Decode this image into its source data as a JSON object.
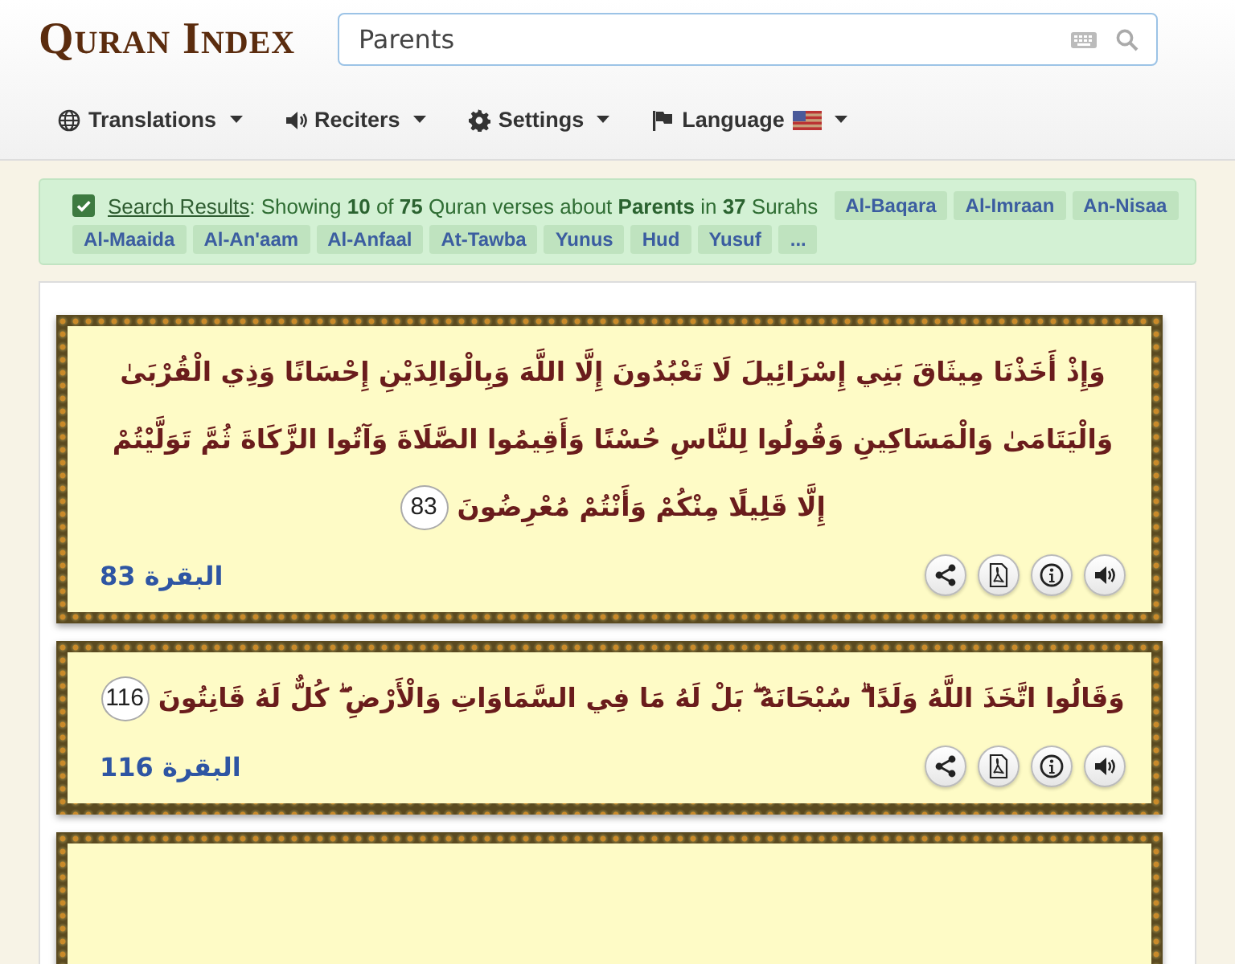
{
  "header": {
    "logo": "Quran Index",
    "search": {
      "value": "Parents"
    }
  },
  "nav": [
    {
      "kind": "globe",
      "label": "Translations"
    },
    {
      "kind": "speaker",
      "label": "Reciters"
    },
    {
      "kind": "gear",
      "label": "Settings"
    },
    {
      "kind": "flag",
      "label": "Language"
    }
  ],
  "results": {
    "checked": true,
    "link": "Search Results",
    "summary": ": Showing **10** of **75** Quran verses about **Parents** in **37** Surahs",
    "surahs": [
      "Al-Baqara",
      "Al-Imraan",
      "An-Nisaa",
      "Al-Maaida",
      "Al-An'aam",
      "Al-Anfaal",
      "At-Tawba",
      "Yunus",
      "Hud",
      "Yusuf",
      "..."
    ]
  },
  "verses": [
    {
      "text": "وَإِذْ أَخَذْنَا مِيثَاقَ بَنِي إِسْرَائِيلَ لَا تَعْبُدُونَ إِلَّا اللَّهَ وَبِالْوَالِدَيْنِ إِحْسَانًا وَذِي الْقُرْبَىٰ وَالْيَتَامَىٰ وَالْمَسَاكِينِ وَقُولُوا لِلنَّاسِ حُسْنًا وَأَقِيمُوا الصَّلَاةَ وَآتُوا الزَّكَاةَ ثُمَّ تَوَلَّيْتُمْ إِلَّا قَلِيلًا مِنْكُمْ وَأَنْتُمْ مُعْرِضُونَ",
      "number": "83",
      "reference": "البقرة 83"
    },
    {
      "text": "وَقَالُوا اتَّخَذَ اللَّهُ وَلَدًا ۗ سُبْحَانَهُ ۖ بَلْ لَهُ مَا فِي السَّمَاوَاتِ وَالْأَرْضِ ۖ كُلٌّ لَهُ قَانِتُونَ",
      "number": "116",
      "reference": "البقرة 116"
    }
  ]
}
